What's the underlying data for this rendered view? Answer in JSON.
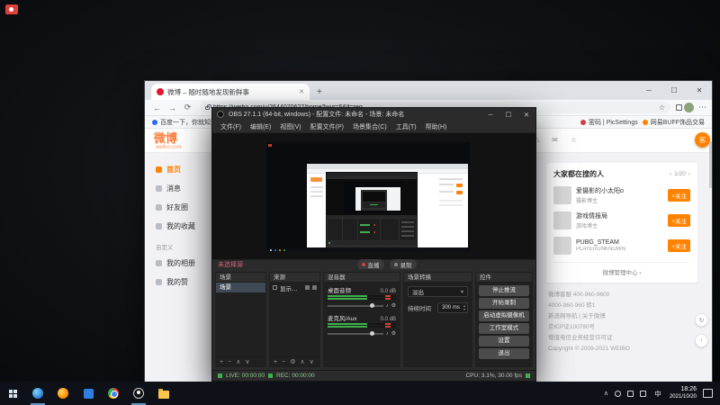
{
  "colors": {
    "weibo_orange": "#ff8200",
    "weibo_red": "#e6162d",
    "meter_green": "#3faf4d",
    "meter_red": "#cf4436"
  },
  "browser": {
    "tab_title": "微博 – 随时随地发现新鲜事",
    "url": "https://weibo.com/u/2644070627/home?wvr=5&lf=reg",
    "bookmarks": {
      "item1": "百度一下，你就知道",
      "item2": "密码 | PicSettings",
      "item3": "网易BUFF饰品交易"
    }
  },
  "weibo": {
    "logo": "微博",
    "logo_sub": "weibo.com",
    "nav": [
      {
        "label": "首页"
      },
      {
        "label": "消息"
      },
      {
        "label": "好友圈"
      },
      {
        "label": "我的收藏"
      }
    ],
    "custom_label": "自定义",
    "custom": [
      {
        "label": "我的相册"
      },
      {
        "label": "我的赞"
      }
    ],
    "suggest": {
      "title": "大家都在搜的人",
      "pager": "1/20",
      "users": [
        {
          "name": "爱摄影的小太阳o",
          "desc": "摄影博主",
          "follow": "+关注"
        },
        {
          "name": "游戏情报局",
          "desc": "游戏博主",
          "follow": "+关注"
        },
        {
          "name": "PUBG_STEAM",
          "desc": "PLAYERUNKNOWN",
          "follow": "+关注"
        }
      ],
      "more": "微博管理中心 ›"
    },
    "footer": [
      "微博客服 400-960-9600",
      "4000-960-960 转1",
      "新浪网导航 | 关于微博",
      "京ICP证100780号",
      "增值电信业务经营许可证",
      "Copyright © 2009-2021 WEIBO"
    ],
    "feedback": "客"
  },
  "obs": {
    "title": "OBS 27.1.1 (64-bit, windows) - 配置文件: 未命名 - 场景: 未命名",
    "menus": [
      {
        "label": "文件(F)"
      },
      {
        "label": "编辑(E)"
      },
      {
        "label": "视图(V)"
      },
      {
        "label": "配置文件(P)"
      },
      {
        "label": "场景集合(C)"
      },
      {
        "label": "工具(T)"
      },
      {
        "label": "帮助(H)"
      }
    ],
    "no_source": "未选择源",
    "toggles": [
      {
        "label": "直播"
      },
      {
        "label": "录制"
      }
    ],
    "scenes": {
      "title": "场景",
      "item": "场景"
    },
    "sources": {
      "title": "来源",
      "item": "显示器采集"
    },
    "mixer": {
      "title": "混音器",
      "channels": [
        {
          "name": "桌面音频",
          "db": "0.0 dB"
        },
        {
          "name": "麦克风/Aux",
          "db": "0.0 dB"
        }
      ]
    },
    "transitions": {
      "title": "场景转换",
      "value": "淡出",
      "duration_label": "持续时间",
      "duration": "300 ms"
    },
    "controls": {
      "title": "控件",
      "buttons": [
        {
          "label": "停止推流"
        },
        {
          "label": "开始录制"
        },
        {
          "label": "启动虚拟摄像机"
        },
        {
          "label": "工作室模式"
        },
        {
          "label": "设置"
        },
        {
          "label": "退出"
        }
      ]
    },
    "status": {
      "live": "LIVE: 00:00:00",
      "rec": "REC: 00:00:00",
      "cpu": "CPU: 3.1%, 30.00 fps"
    }
  },
  "taskbar": {
    "lang": "中",
    "time": "18:26",
    "date": "2021/10/20"
  }
}
